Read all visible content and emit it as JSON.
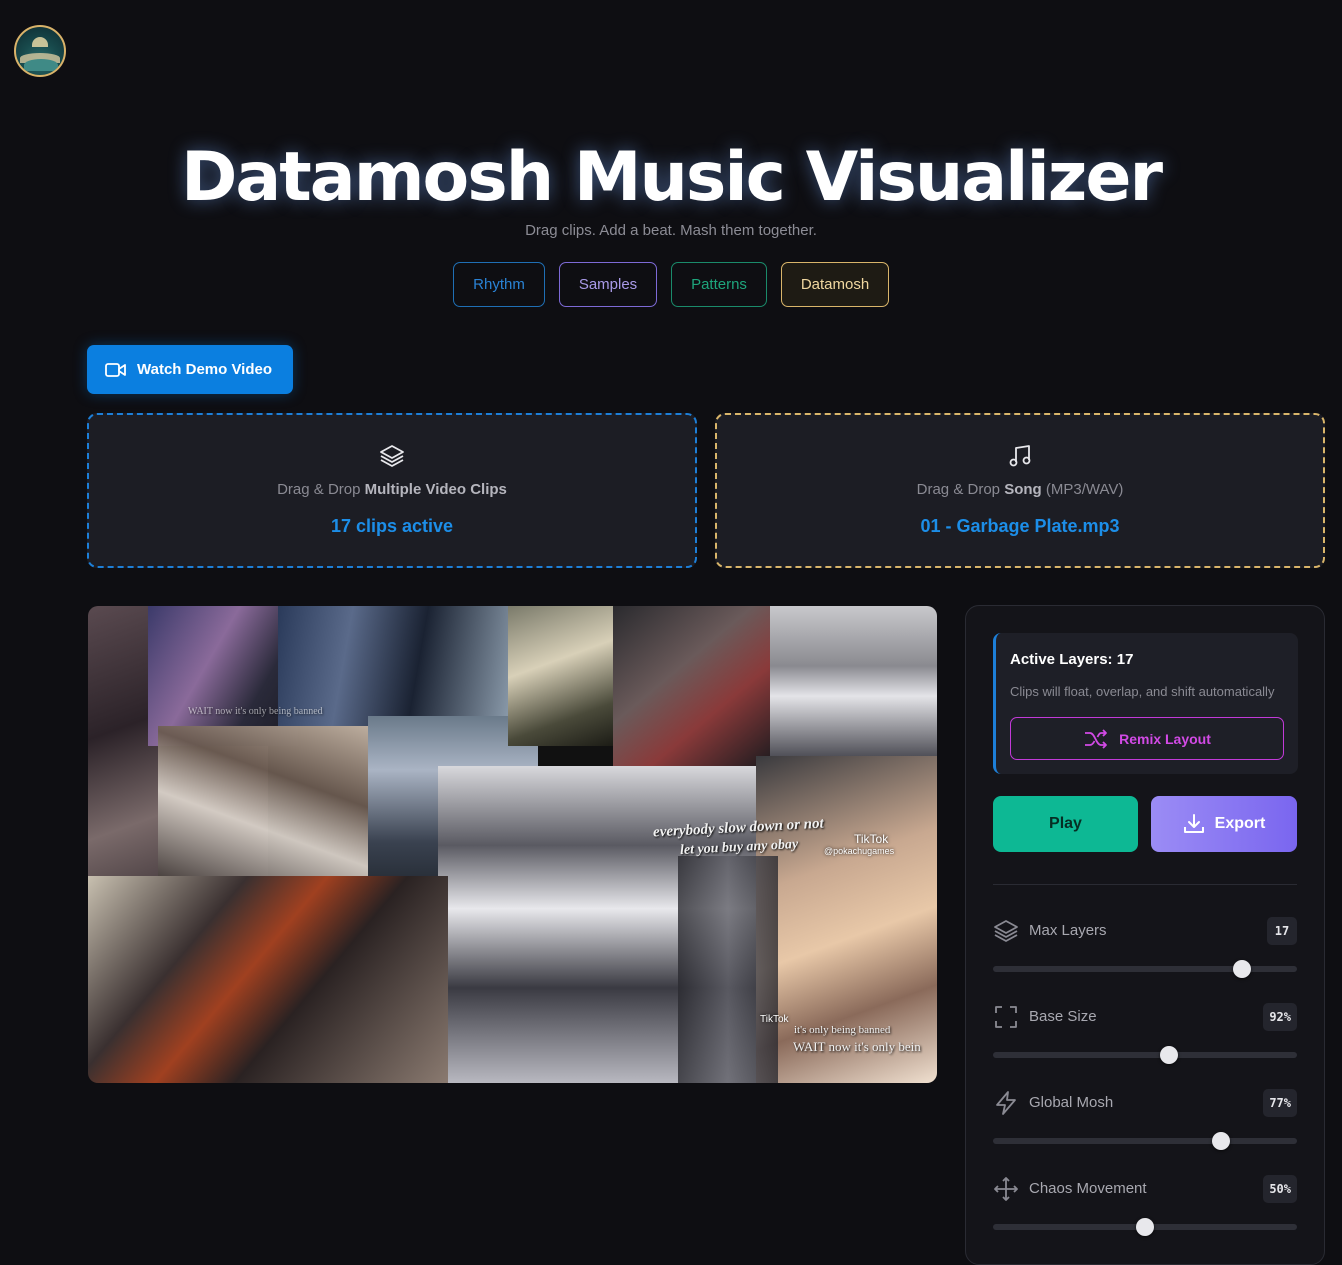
{
  "header": {
    "title": "Datamosh Music Visualizer",
    "subtitle": "Drag clips. Add a beat. Mash them together."
  },
  "tabs": [
    {
      "label": "Rhythm",
      "color": "#2a82d4"
    },
    {
      "label": "Samples",
      "color": "#a99ae8"
    },
    {
      "label": "Patterns",
      "color": "#1ea57c"
    },
    {
      "label": "Datamosh",
      "color": "#f0d7a0",
      "active": true
    }
  ],
  "demo_button": {
    "label": "Watch Demo Video",
    "icon": "video-camera-icon"
  },
  "drop_clips": {
    "icon": "layers-icon",
    "hint_prefix": "Drag & Drop ",
    "hint_bold": "Multiple Video Clips",
    "hint_suffix": "",
    "status": "17 clips active"
  },
  "drop_song": {
    "icon": "music-note-icon",
    "hint_prefix": "Drag & Drop ",
    "hint_bold": "Song",
    "hint_suffix": " (MP3/WAV)",
    "status": "01 - Garbage Plate.mp3"
  },
  "canvas": {
    "captions": [
      "everybody slow down or not",
      "let you buy any obay",
      "WAIT now it's only bein",
      "it's only being banned",
      "WAIT now it's only being banned"
    ],
    "watermarks": [
      "TikTok",
      "@pokachugames",
      "TikTok"
    ]
  },
  "panel": {
    "layers_title": "Active Layers: 17",
    "layers_desc": "Clips will float, overlap, and shift automatically",
    "remix_label": "Remix Layout",
    "play_label": "Play",
    "export_label": "Export",
    "sliders": [
      {
        "label": "Max Layers",
        "display": "17",
        "fraction": 0.82,
        "icon": "layers-icon"
      },
      {
        "label": "Base Size",
        "display": "92%",
        "fraction": 0.58,
        "icon": "focus-frame-icon"
      },
      {
        "label": "Global Mosh",
        "display": "77%",
        "fraction": 0.75,
        "icon": "lightning-icon"
      },
      {
        "label": "Chaos Movement",
        "display": "50%",
        "fraction": 0.5,
        "icon": "move-arrows-icon"
      }
    ]
  }
}
